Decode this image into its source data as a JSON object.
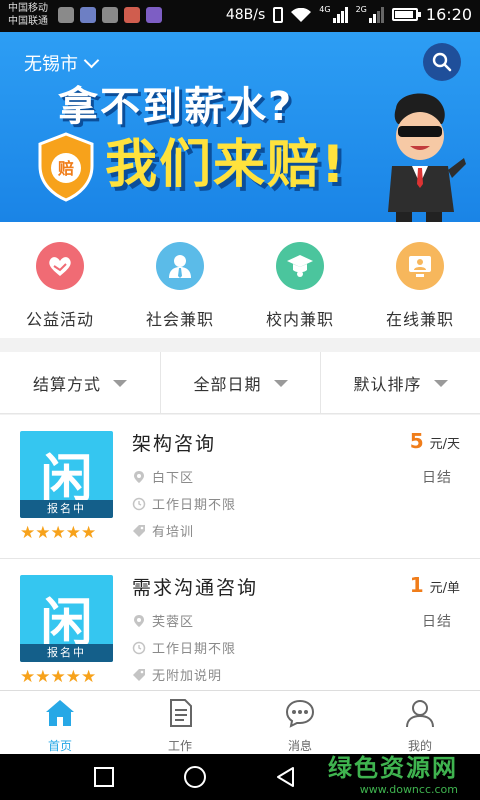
{
  "status_bar": {
    "carrier_1": "中国移动",
    "carrier_2": "中国联通",
    "net_speed": "48B/s",
    "signal_tag_1": "4G",
    "signal_tag_2": "2G",
    "time": "16:20"
  },
  "banner": {
    "city": "无锡市",
    "headline_1": "拿不到薪水?",
    "headline_2": "我们来赔!",
    "shield_text": "赔"
  },
  "categories": [
    {
      "label": "公益活动",
      "color": "#f06b74",
      "icon": "heart-hand-icon"
    },
    {
      "label": "社会兼职",
      "color": "#5bbbe8",
      "icon": "person-icon"
    },
    {
      "label": "校内兼职",
      "color": "#4bc59d",
      "icon": "graduation-cap-icon"
    },
    {
      "label": "在线兼职",
      "color": "#f7b75c",
      "icon": "monitor-icon"
    }
  ],
  "filters": [
    {
      "label": "结算方式"
    },
    {
      "label": "全部日期"
    },
    {
      "label": "默认排序"
    }
  ],
  "jobs": [
    {
      "title": "架构咨询",
      "price": "5",
      "unit": "元/天",
      "settlement": "日结",
      "district": "白下区",
      "date": "工作日期不限",
      "note": "有培训",
      "thumb_glyph": "闲",
      "thumb_tag": "报名中",
      "stars": "★★★★★",
      "rating": 5
    },
    {
      "title": "需求沟通咨询",
      "price": "1",
      "unit": "元/单",
      "settlement": "日结",
      "district": "芙蓉区",
      "date": "工作日期不限",
      "note": "无附加说明",
      "thumb_glyph": "闲",
      "thumb_tag": "报名中",
      "stars": "★★★★★",
      "rating": 5
    }
  ],
  "tabs": [
    {
      "label": "首页",
      "icon": "home-icon",
      "active": true
    },
    {
      "label": "工作",
      "icon": "document-icon",
      "active": false
    },
    {
      "label": "消息",
      "icon": "chat-bubble-icon",
      "active": false
    },
    {
      "label": "我的",
      "icon": "user-icon",
      "active": false
    }
  ],
  "watermark": {
    "title": "绿色资源网",
    "url": "www.downcc.com"
  },
  "colors": {
    "accent": "#27a8e6",
    "price": "#f07d1a",
    "banner": "#2394ee",
    "star": "#f7a21b"
  }
}
